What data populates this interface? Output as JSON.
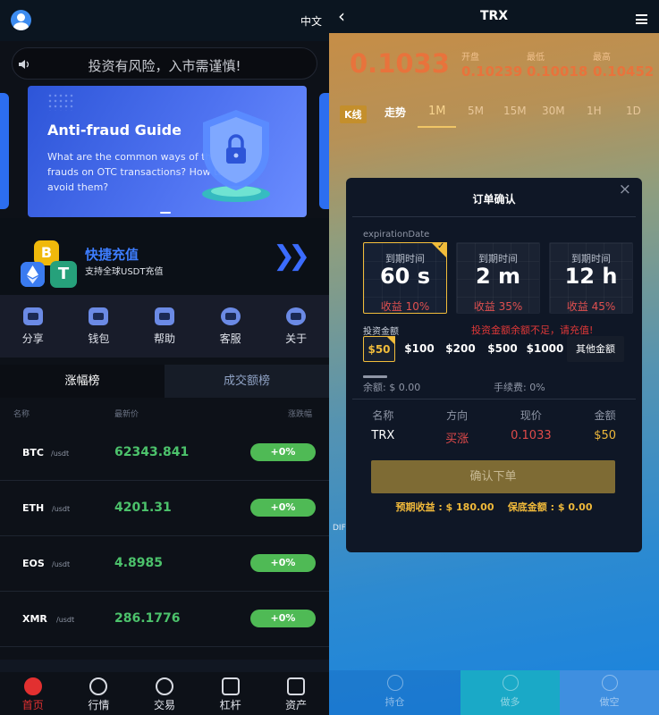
{
  "left": {
    "lang": "中文",
    "notice": "投资有风险，入市需谨慎!",
    "banner": {
      "title": "Anti-fraud Guide",
      "desc": "What are the common ways of the frauds on OTC transactions? How to avoid them?"
    },
    "recharge": {
      "title": "快捷充值",
      "subtitle": "支持全球USDT充值",
      "coin_b": "B",
      "coin_t": "T"
    },
    "menu": [
      {
        "label": "分享"
      },
      {
        "label": "钱包"
      },
      {
        "label": "帮助"
      },
      {
        "label": "客服"
      },
      {
        "label": "关于"
      }
    ],
    "tabs": [
      {
        "label": "涨幅榜"
      },
      {
        "label": "成交额榜"
      }
    ],
    "market_headers": {
      "name": "名称",
      "price": "最新价",
      "change": "涨跌幅"
    },
    "market": [
      {
        "symbol": "BTC",
        "quote": "/usdt",
        "price": "62343.841",
        "change": "+0%"
      },
      {
        "symbol": "ETH",
        "quote": "/usdt",
        "price": "4201.31",
        "change": "+0%"
      },
      {
        "symbol": "EOS",
        "quote": "/usdt",
        "price": "4.8985",
        "change": "+0%"
      },
      {
        "symbol": "XMR",
        "quote": "/usdt",
        "price": "286.1776",
        "change": "+0%"
      }
    ],
    "bottom_nav": [
      {
        "label": "首页"
      },
      {
        "label": "行情"
      },
      {
        "label": "交易"
      },
      {
        "label": "杠杆"
      },
      {
        "label": "资产"
      }
    ]
  },
  "right": {
    "title": "TRX",
    "price": "0.1033",
    "stats": [
      {
        "label": "开盘",
        "value": "0.10239"
      },
      {
        "label": "最低",
        "value": "0.10018"
      },
      {
        "label": "最高",
        "value": "0.10452"
      }
    ],
    "kbar": {
      "kline": "K线",
      "trend": "走势",
      "intervals": [
        "1M",
        "5M",
        "15M",
        "30M",
        "1H",
        "1D"
      ]
    },
    "dif": "DIF",
    "modal": {
      "title": "订单确认",
      "close": "×",
      "expiration_label": "expirationDate",
      "cards": [
        {
          "label": "到期时间",
          "value": "60 s",
          "income": "收益 10%"
        },
        {
          "label": "到期时间",
          "value": "2 m",
          "income": "收益 35%"
        },
        {
          "label": "到期时间",
          "value": "12 h",
          "income": "收益 45%"
        }
      ],
      "invest_label": "投资金额",
      "warning": "投资金额余额不足，请充值!",
      "amounts": [
        "$50",
        "$100",
        "$200",
        "$500",
        "$1000"
      ],
      "other_amount": "其他金额",
      "balance": "余额: $ 0.00",
      "fee": "手续费: 0%",
      "summary_headers": [
        "名称",
        "方向",
        "现价",
        "金额"
      ],
      "summary_values": [
        "TRX",
        "买涨",
        "0.1033",
        "$50"
      ],
      "confirm": "确认下单",
      "expected": "预期收益 : $ 180.00",
      "margin": "保底金额 : $ 0.00"
    },
    "bottom": [
      {
        "label": "持仓"
      },
      {
        "label": "做多"
      },
      {
        "label": "做空"
      }
    ]
  },
  "colors": {
    "accent_gold": "#f1bc3b",
    "up_green": "#4fba55",
    "warn_red": "#e03838",
    "price_orange": "#e8733c",
    "brand_blue": "#3d7dff"
  }
}
